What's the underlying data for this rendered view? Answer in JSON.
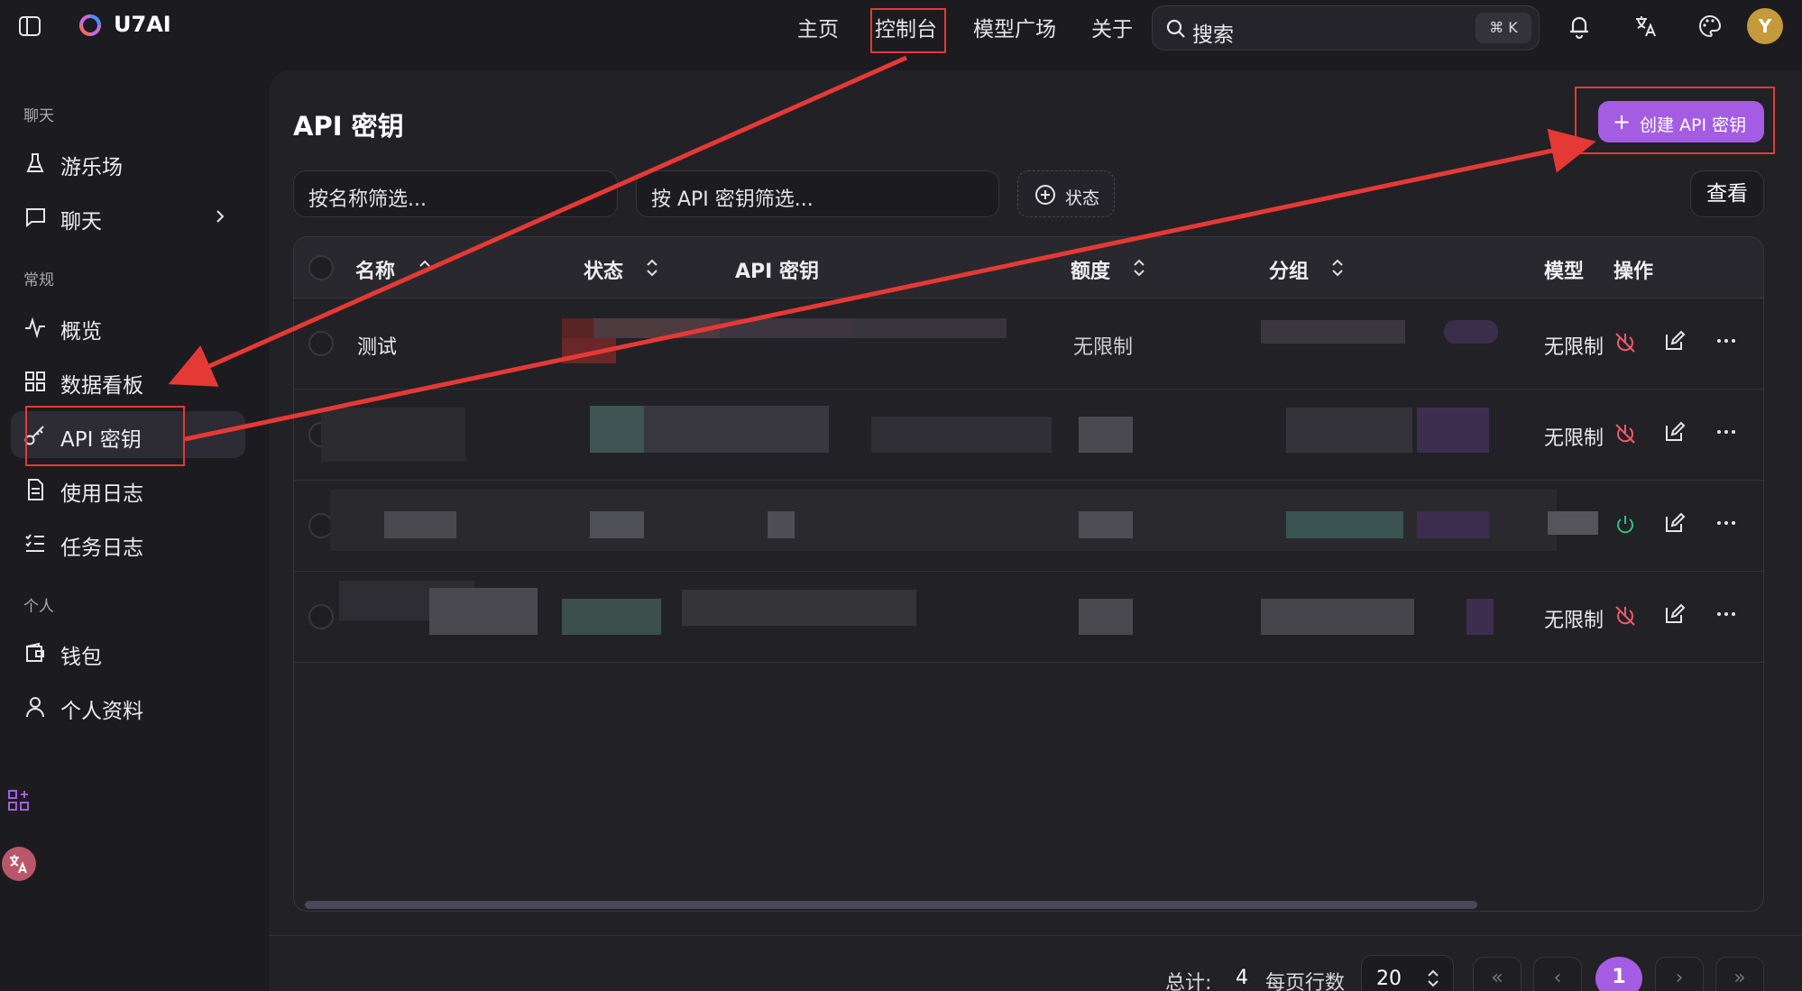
{
  "app": {
    "brand": "U7AI",
    "avatar_initial": "Y"
  },
  "nav": {
    "items": [
      "主页",
      "控制台",
      "模型广场",
      "关于"
    ]
  },
  "search": {
    "placeholder": "搜索",
    "shortcut": "⌘ K"
  },
  "sidebar": {
    "sections": [
      {
        "label": "聊天",
        "items": [
          {
            "label": "游乐场",
            "icon": "flask-icon"
          },
          {
            "label": "聊天",
            "icon": "chat-icon"
          }
        ]
      },
      {
        "label": "常规",
        "items": [
          {
            "label": "概览",
            "icon": "activity-icon"
          },
          {
            "label": "数据看板",
            "icon": "dashboard-icon"
          },
          {
            "label": "API 密钥",
            "icon": "key-icon"
          },
          {
            "label": "使用日志",
            "icon": "file-icon"
          },
          {
            "label": "任务日志",
            "icon": "list-icon"
          }
        ]
      },
      {
        "label": "个人",
        "items": [
          {
            "label": "钱包",
            "icon": "wallet-icon"
          },
          {
            "label": "个人资料",
            "icon": "user-icon"
          }
        ]
      }
    ]
  },
  "page": {
    "title": "API 密钥",
    "create_button": "创建 API 密钥",
    "filter_name_placeholder": "按名称筛选...",
    "filter_key_placeholder": "按 API 密钥筛选...",
    "status_chip": "状态",
    "view_button": "查看"
  },
  "table": {
    "columns": [
      "名称",
      "状态",
      "API 密钥",
      "额度",
      "分组",
      "模型",
      "操作"
    ],
    "rows": [
      {
        "name": "测试",
        "quota": "无限制",
        "model": "无限制"
      },
      {
        "name": "",
        "quota": "",
        "model": "无限制"
      },
      {
        "name": "",
        "quota": "",
        "model": ""
      },
      {
        "name": "",
        "quota": "",
        "model": "无限制"
      }
    ]
  },
  "pagination": {
    "total_label": "总计:",
    "total": "4",
    "per_page_label": "每页行数",
    "per_page": "20",
    "current_page": "1"
  },
  "colors": {
    "accent": "#a45de2",
    "annotation": "#e53935",
    "background": "#1c1b1f"
  }
}
